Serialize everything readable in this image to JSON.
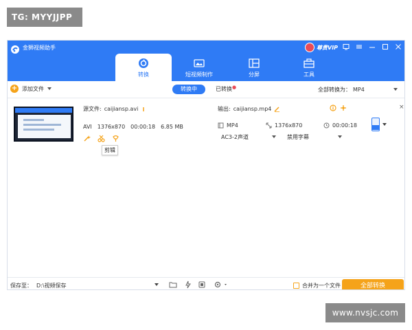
{
  "watermarks": {
    "top": "TG: MYYJJPP",
    "bottom": "www.nvsjc.com"
  },
  "window": {
    "title": "金狮视频助手",
    "vip_label": "尊贵VIP"
  },
  "tabs": [
    {
      "label": "转换",
      "icon": "convert-icon",
      "active": true
    },
    {
      "label": "短视频制作",
      "icon": "short-video-icon",
      "active": false
    },
    {
      "label": "分屏",
      "icon": "split-screen-icon",
      "active": false
    },
    {
      "label": "工具",
      "icon": "toolbox-icon",
      "active": false
    }
  ],
  "toolbar": {
    "add_file": "添加文件",
    "converting": "转换中",
    "converted": "已转换",
    "convert_all_to": "全部转换为：",
    "output_format": "MP4"
  },
  "file": {
    "source_label": "源文件:",
    "source_name": "caijiansp.avi",
    "format": "AVI",
    "resolution": "1376x870",
    "duration": "00:00:18",
    "size": "6.85 MB",
    "tooltip": "剪辑",
    "output_label": "输出:",
    "output_name": "caijiansp.mp4",
    "out_format": "MP4",
    "out_resolution": "1376x870",
    "out_duration": "00:00:18",
    "audio": "AC3-2声道",
    "subtitle": "禁用字幕",
    "close": "×"
  },
  "bottom": {
    "save_to": "保存至：",
    "save_path": "D:\\视频保存",
    "merge": "合并为一个文件",
    "convert_all": "全部转换"
  },
  "colors": {
    "brand": "#2f7bf5",
    "accent": "#f5a31a",
    "vip": "#e94b57"
  }
}
